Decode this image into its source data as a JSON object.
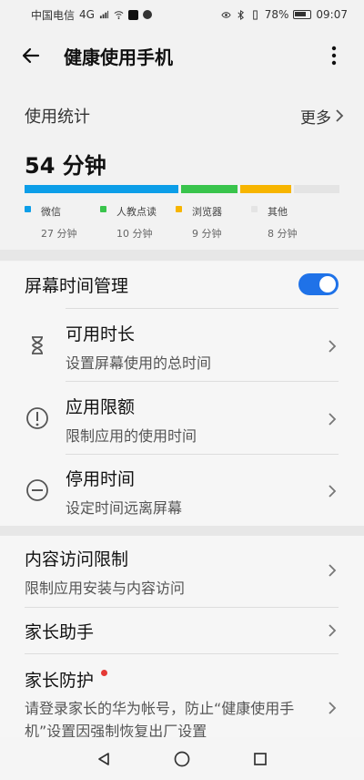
{
  "status_bar": {
    "carrier": "中国电信",
    "network": "4G",
    "battery": "78%",
    "time": "09:07"
  },
  "app_bar": {
    "title": "健康使用手机",
    "back_icon": "back-arrow-icon",
    "more_icon": "more-vertical-icon"
  },
  "usage": {
    "title": "使用统计",
    "more_label": "更多",
    "total": "54 分钟",
    "segments": [
      {
        "name": "微信",
        "time": "27 分钟",
        "minutes": 27,
        "color": "#0c9ee8"
      },
      {
        "name": "人教点读",
        "time": "10 分钟",
        "minutes": 10,
        "color": "#39c44c"
      },
      {
        "name": "浏览器",
        "time": "9 分钟",
        "minutes": 9,
        "color": "#f7b500"
      },
      {
        "name": "其他",
        "time": "8 分钟",
        "minutes": 8,
        "color": "#e4e4e4"
      }
    ]
  },
  "screen_time": {
    "title": "屏幕时间管理",
    "enabled": true,
    "items": [
      {
        "title": "可用时长",
        "subtitle": "设置屏幕使用的总时间",
        "icon": "hourglass-icon"
      },
      {
        "title": "应用限额",
        "subtitle": "限制应用的使用时间",
        "icon": "exclamation-circle-icon"
      },
      {
        "title": "停用时间",
        "subtitle": "设定时间远离屏幕",
        "icon": "minus-circle-icon"
      }
    ]
  },
  "content": {
    "items": [
      {
        "title": "内容访问限制",
        "subtitle": "限制应用安装与内容访问"
      },
      {
        "title": "家长助手"
      },
      {
        "title": "家长防护",
        "subtitle": "请登录家长的华为帐号，防止“健康使用手机”设置因强制恢复出厂设置"
      }
    ]
  },
  "nav": {
    "back": "back-triangle-icon",
    "home": "home-circle-icon",
    "recent": "recent-square-icon"
  }
}
